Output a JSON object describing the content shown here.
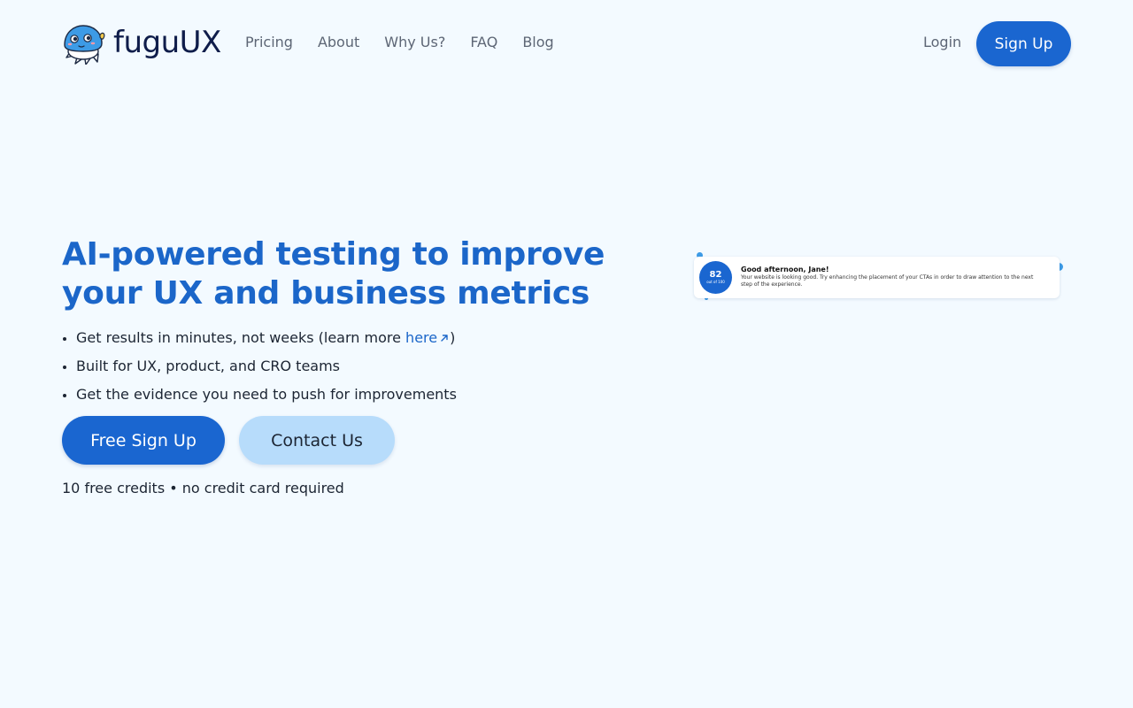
{
  "brand": {
    "name": "fuguUX",
    "logo_icon": "pufferfish-icon",
    "accent_color": "#1a66d0",
    "light_accent_color": "#b7dcfb"
  },
  "nav": {
    "items": [
      "Pricing",
      "About",
      "Why Us?",
      "FAQ",
      "Blog"
    ],
    "login_label": "Login",
    "signup_label": "Sign Up"
  },
  "hero": {
    "title": "AI-powered testing to improve your UX and business metrics",
    "bullets": [
      {
        "text": "Get results in minutes, not weeks (learn more ",
        "link_text": "here",
        "link_icon": "external-arrow-icon",
        "suffix": ")"
      },
      {
        "text": "Built for UX, product, and CRO teams"
      },
      {
        "text": "Get the evidence you need to push for improvements"
      }
    ],
    "primary_cta": "Free Sign Up",
    "secondary_cta": "Contact Us",
    "fine_print": "10 free credits • no credit card required"
  },
  "preview_card": {
    "score": "82",
    "score_sub": "out of 100",
    "greeting": "Good afternoon, Jane!",
    "message": "Your website is looking good. Try enhancing the placement of your CTAs in order to draw attention to the next step of the experience."
  }
}
